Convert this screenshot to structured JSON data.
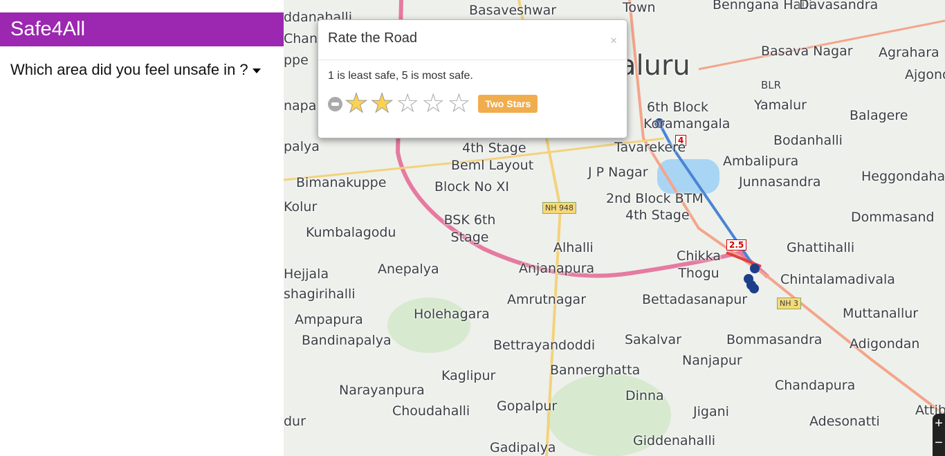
{
  "app": {
    "title": "Safe4All",
    "question": "Which area did you feel unsafe in ?"
  },
  "modal": {
    "title": "Rate the Road",
    "close": "×",
    "hint": "1 is least safe, 5 is most safe.",
    "rating": 2,
    "max": 5,
    "rating_label": "Two Stars",
    "star_color": "#fcd24f",
    "badge_color": "#f0ad4e"
  },
  "map": {
    "labels": [
      "Basaveshwar",
      "Town",
      "Benngana Halli",
      "Davasandra",
      "ddanahalli",
      "Chan",
      "ppe",
      "aluru",
      "Basava Nagar",
      "Agrahara",
      "Ajgond",
      "BLR",
      "Yamalur",
      "6th Block",
      "Koramangala",
      "Balagere",
      "napa",
      "palya",
      "4th Stage",
      "Tavarekere",
      "Bodanhalli",
      "Beml Layout",
      "J P Nagar",
      "Ambalipura",
      "Bimanakuppe",
      "Block No XI",
      "Junnasandra",
      "Heggondaha",
      "Kolur",
      "2nd Block BTM",
      "4th Stage",
      "BSK 6th Stage",
      "Dommasand",
      "Kumbalagodu",
      "Alhalli",
      "Chikka Thogu",
      "Ghattihalli",
      "Anepalya",
      "Anjanapura",
      "Hejjala",
      "Chintalamadivala",
      "shagirihalli",
      "Amrutnagar",
      "Bettadasanapur",
      "Ampapura",
      "Holehagara",
      "Muttanallur",
      "Bandinapalya",
      "Bettrayandoddi",
      "Sakalvar",
      "Bommasandra",
      "Adigondan",
      "Kaglipur",
      "Nanjapur",
      "Bannerghatta",
      "Narayanpura",
      "Chandapura",
      "Choudahalli",
      "Gopalpur",
      "Dinna",
      "Jigani",
      "Attib",
      "Adesonatti",
      "dur",
      "Gadipalya",
      "Giddenahalli"
    ],
    "route_markers": [
      "4",
      "2.5"
    ],
    "highway_shields": [
      "NH 948",
      "NH 3"
    ],
    "zoom_in": "+",
    "zoom_out": "−"
  }
}
